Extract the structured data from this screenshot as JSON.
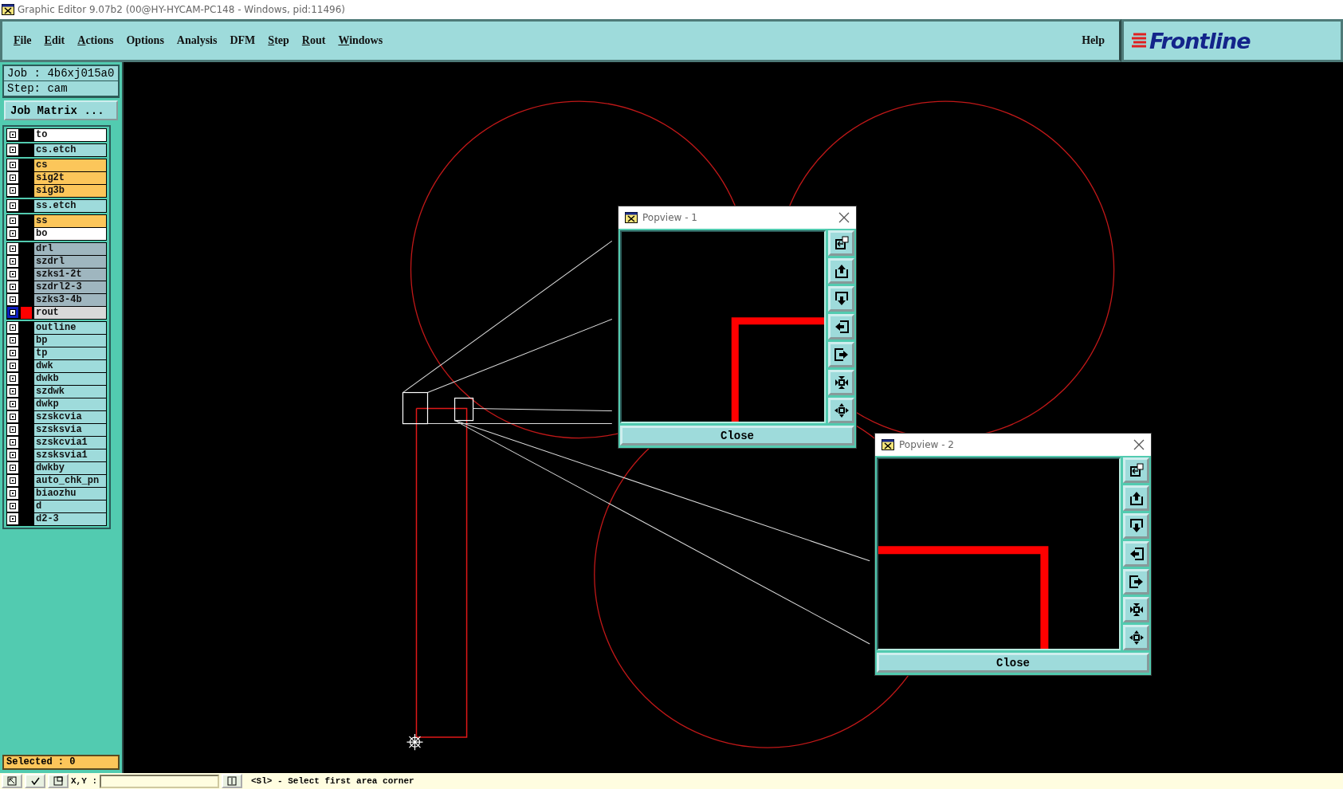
{
  "window": {
    "title": "Graphic Editor 9.07b2 (00@HY-HYCAM-PC148 - Windows, pid:11496)"
  },
  "menu": [
    {
      "label": "File",
      "underlined": true
    },
    {
      "label": "Edit",
      "underlined": true
    },
    {
      "label": "Actions",
      "underlined": true
    },
    {
      "label": "Options",
      "underlined": false
    },
    {
      "label": "Analysis",
      "underlined": false
    },
    {
      "label": "DFM",
      "underlined": false
    },
    {
      "label": "Step",
      "underlined": true
    },
    {
      "label": "Rout",
      "underlined": true
    },
    {
      "label": "Windows",
      "underlined": true
    }
  ],
  "help": "Help",
  "logo": "Frontline",
  "job": {
    "job": "Job : 4b6xj015a0",
    "step": "Step: cam",
    "matrix_button": "Job Matrix ..."
  },
  "layer_groups": [
    [
      {
        "name": "to",
        "color": "#ffffff",
        "active": false
      }
    ],
    [
      {
        "name": "cs.etch",
        "color": "#9edbdb",
        "active": false
      }
    ],
    [
      {
        "name": "cs",
        "color": "#fcc65a",
        "active": false
      },
      {
        "name": "sig2t",
        "color": "#fcc65a",
        "active": false
      },
      {
        "name": "sig3b",
        "color": "#fcc65a",
        "active": false
      }
    ],
    [
      {
        "name": "ss.etch",
        "color": "#9edbdb",
        "active": false
      }
    ],
    [
      {
        "name": "ss",
        "color": "#fcc65a",
        "active": false
      },
      {
        "name": "bo",
        "color": "#ffffff",
        "active": false
      }
    ],
    [
      {
        "name": "drl",
        "color": "#9fb6bf",
        "active": false
      },
      {
        "name": "szdrl",
        "color": "#9fb6bf",
        "active": false
      },
      {
        "name": "szks1-2t",
        "color": "#9fb6bf",
        "active": false
      },
      {
        "name": "szdrl2-3",
        "color": "#9fb6bf",
        "active": false
      },
      {
        "name": "szks3-4b",
        "color": "#9fb6bf",
        "active": false
      },
      {
        "name": "rout",
        "color": "#d9d9d9",
        "active": true
      }
    ],
    [
      {
        "name": "outline",
        "color": "#9edbdb",
        "active": false
      },
      {
        "name": "bp",
        "color": "#9edbdb",
        "active": false
      },
      {
        "name": "tp",
        "color": "#9edbdb",
        "active": false
      },
      {
        "name": "dwk",
        "color": "#9edbdb",
        "active": false
      },
      {
        "name": "dwkb",
        "color": "#9edbdb",
        "active": false
      },
      {
        "name": "szdwk",
        "color": "#9edbdb",
        "active": false
      },
      {
        "name": "dwkp",
        "color": "#9edbdb",
        "active": false
      },
      {
        "name": "szskcvia",
        "color": "#9edbdb",
        "active": false
      },
      {
        "name": "szsksvia",
        "color": "#9edbdb",
        "active": false
      },
      {
        "name": "szskcvia1",
        "color": "#9edbdb",
        "active": false
      },
      {
        "name": "szsksvia1",
        "color": "#9edbdb",
        "active": false
      },
      {
        "name": "dwkby",
        "color": "#9edbdb",
        "active": false
      },
      {
        "name": "auto_chk_pn",
        "color": "#9edbdb",
        "active": false
      },
      {
        "name": "biaozhu",
        "color": "#9edbdb",
        "active": false
      },
      {
        "name": "d",
        "color": "#9edbdb",
        "active": false
      },
      {
        "name": "d2-3",
        "color": "#9edbdb",
        "active": false
      }
    ]
  ],
  "selected": "Selected : 0",
  "popviews": [
    {
      "title": "Popview - 1",
      "close": "Close"
    },
    {
      "title": "Popview - 2",
      "close": "Close"
    }
  ],
  "status": {
    "xy_label": "X,Y :",
    "prompt": "<Sl> - Select first area corner"
  }
}
